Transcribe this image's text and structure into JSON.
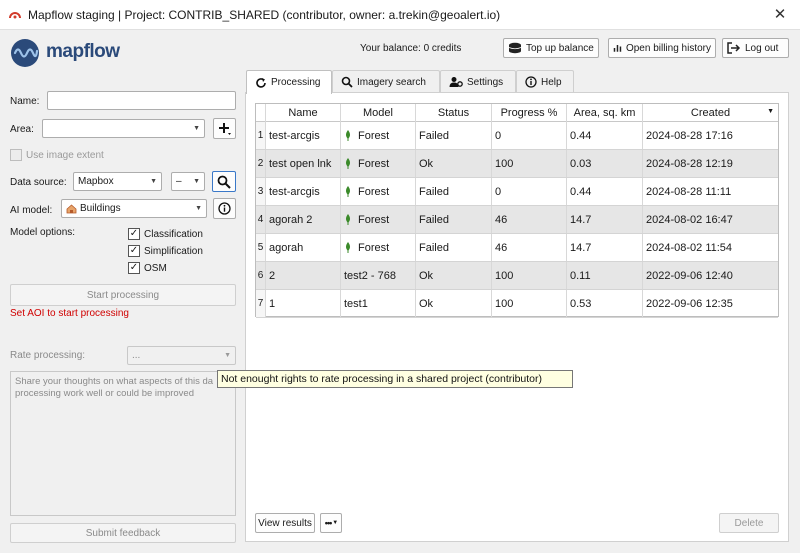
{
  "window": {
    "title": "Mapflow staging | Project: CONTRIB_SHARED (contributor, owner: a.trekin@geoalert.io)",
    "close_glyph": "✕"
  },
  "header": {
    "logo_text": "mapflow",
    "balance": "Your balance: 0 credits",
    "top_up": "Top up balance",
    "billing": "Open billing history",
    "logout": "Log out"
  },
  "left": {
    "name_label": "Name:",
    "name_value": "",
    "area_label": "Area:",
    "area_value": "",
    "use_extent": "Use image extent",
    "data_source_label": "Data source:",
    "data_source_value": "Mapbox",
    "data_source_sub": "–",
    "ai_model_label": "AI model:",
    "ai_model_value": "Buildings",
    "model_options_label": "Model options:",
    "options": [
      {
        "label": "Classification",
        "checked": true
      },
      {
        "label": "Simplification",
        "checked": true
      },
      {
        "label": "OSM",
        "checked": true
      }
    ],
    "start_processing": "Start processing",
    "error": "Set AOI to start processing",
    "rate_label": "Rate processing:",
    "rate_value": "...",
    "feedback_placeholder": "Share your thoughts on what aspects of this da processing work well or could be improved",
    "submit_feedback": "Submit feedback"
  },
  "tabs": [
    {
      "label": "Processing",
      "icon": "refresh-icon",
      "active": true
    },
    {
      "label": "Imagery search",
      "icon": "magnifier-icon",
      "active": false
    },
    {
      "label": "Settings",
      "icon": "users-gear-icon",
      "active": false
    },
    {
      "label": "Help",
      "icon": "info-icon",
      "active": false
    }
  ],
  "table": {
    "columns": [
      "Name",
      "Model",
      "Status",
      "Progress %",
      "Area, sq. km",
      "Created"
    ],
    "rows": [
      {
        "num": "1",
        "name": "test-arcgis",
        "model": "Forest",
        "leaf": true,
        "status": "Failed",
        "progress": "0",
        "area": "0.44",
        "created": "2024-08-28 17:16"
      },
      {
        "num": "2",
        "name": "test open lnk",
        "model": "Forest",
        "leaf": true,
        "status": "Ok",
        "progress": "100",
        "area": "0.03",
        "created": "2024-08-28 12:19"
      },
      {
        "num": "3",
        "name": "test-arcgis",
        "model": "Forest",
        "leaf": true,
        "status": "Failed",
        "progress": "0",
        "area": "0.44",
        "created": "2024-08-28 11:11"
      },
      {
        "num": "4",
        "name": "agorah 2",
        "model": "Forest",
        "leaf": true,
        "status": "Failed",
        "progress": "46",
        "area": "14.7",
        "created": "2024-08-02 16:47"
      },
      {
        "num": "5",
        "name": "agorah",
        "model": "Forest",
        "leaf": true,
        "status": "Failed",
        "progress": "46",
        "area": "14.7",
        "created": "2024-08-02 11:54"
      },
      {
        "num": "6",
        "name": "2",
        "model": "test2 - 768",
        "leaf": false,
        "status": "Ok",
        "progress": "100",
        "area": "0.11",
        "created": "2022-09-06 12:40"
      },
      {
        "num": "7",
        "name": "1",
        "model": "test1",
        "leaf": false,
        "status": "Ok",
        "progress": "100",
        "area": "0.53",
        "created": "2022-09-06 12:35"
      }
    ]
  },
  "tooltip": "Not enought rights to rate processing in a shared project (contributor)",
  "footer": {
    "view_results": "View results",
    "more": "•••",
    "delete": "Delete"
  },
  "colors": {
    "accent_logo": "#2b4a7a",
    "error": "#d00000",
    "leaf": "#3b8a2a",
    "app_icon": "#d23b2b"
  }
}
